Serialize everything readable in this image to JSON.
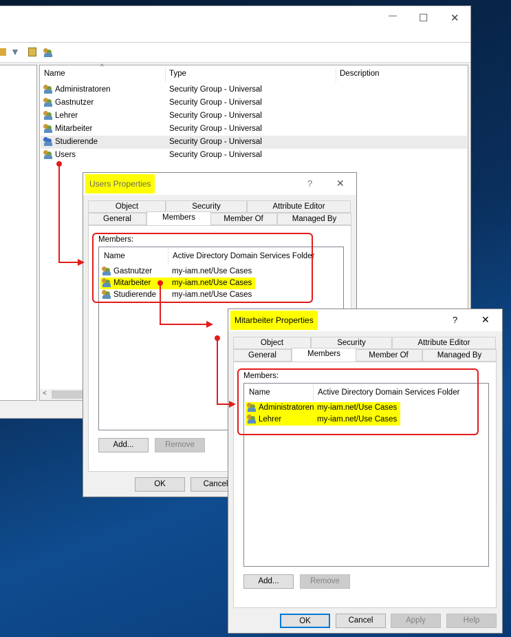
{
  "main_window": {
    "controls": {
      "minimize": "—",
      "maximize": "☐",
      "close": "✕"
    },
    "toolbar_icons": [
      "folder-icon",
      "filter-icon",
      "find-icon",
      "delegate-icon"
    ],
    "columns": [
      "Name",
      "Type",
      "Description"
    ],
    "rows": [
      {
        "name": "Administratoren",
        "type": "Security Group - Universal",
        "icon": "group-icon"
      },
      {
        "name": "Gastnutzer",
        "type": "Security Group - Universal",
        "icon": "group-icon"
      },
      {
        "name": "Lehrer",
        "type": "Security Group - Universal",
        "icon": "group-icon"
      },
      {
        "name": "Mitarbeiter",
        "type": "Security Group - Universal",
        "icon": "group-icon"
      },
      {
        "name": "Studierende",
        "type": "Security Group - Universal",
        "icon": "group-blue-icon",
        "selected": true
      },
      {
        "name": "Users",
        "type": "Security Group - Universal",
        "icon": "group-icon"
      }
    ]
  },
  "users_dialog": {
    "title": "Users Properties",
    "help": "?",
    "close": "✕",
    "tabs_top": [
      "Object",
      "Security",
      "Attribute Editor"
    ],
    "tabs_bottom": [
      "General",
      "Members",
      "Member Of",
      "Managed By"
    ],
    "active_tab": "Members",
    "members_label": "Members:",
    "columns": [
      "Name",
      "Active Directory Domain Services Folder"
    ],
    "members": [
      {
        "name": "Gastnutzer",
        "folder": "my-iam.net/Use Cases"
      },
      {
        "name": "Mitarbeiter",
        "folder": "my-iam.net/Use Cases",
        "highlighted": true
      },
      {
        "name": "Studierende",
        "folder": "my-iam.net/Use Cases"
      }
    ],
    "buttons": {
      "add": "Add...",
      "remove": "Remove",
      "ok": "OK",
      "cancel": "Cancel"
    }
  },
  "mitarbeiter_dialog": {
    "title": "Mitarbeiter Properties",
    "help": "?",
    "close": "✕",
    "tabs_top": [
      "Object",
      "Security",
      "Attribute Editor"
    ],
    "tabs_bottom": [
      "General",
      "Members",
      "Member Of",
      "Managed By"
    ],
    "active_tab": "Members",
    "members_label": "Members:",
    "columns": [
      "Name",
      "Active Directory Domain Services Folder"
    ],
    "members": [
      {
        "name": "Administratoren",
        "folder": "my-iam.net/Use Cases",
        "highlighted": true
      },
      {
        "name": "Lehrer",
        "folder": "my-iam.net/Use Cases",
        "highlighted": true
      }
    ],
    "buttons": {
      "add": "Add...",
      "remove": "Remove",
      "ok": "OK",
      "cancel": "Cancel",
      "apply": "Apply",
      "help": "Help"
    }
  },
  "colors": {
    "highlight": "#ffff00",
    "annotation": "#e31b1b",
    "accent": "#0078d7"
  }
}
